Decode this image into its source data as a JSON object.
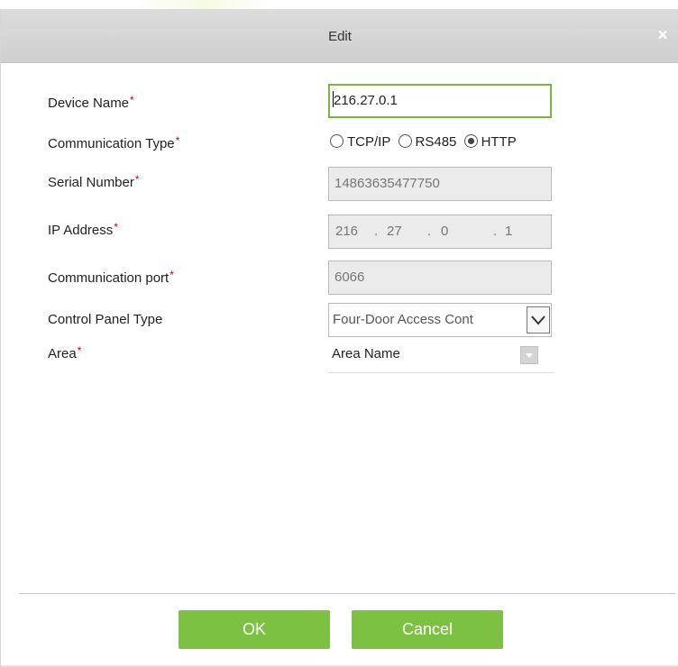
{
  "dialog": {
    "title": "Edit",
    "close_glyph": "×"
  },
  "form": {
    "device_name": {
      "label": "Device Name",
      "required_mark": "*",
      "value": "216.27.0.1"
    },
    "communication_type": {
      "label": "Communication Type",
      "required_mark": "*",
      "options": [
        "TCP/IP",
        "RS485",
        "HTTP"
      ],
      "selected": "HTTP"
    },
    "serial_number": {
      "label": "Serial Number",
      "required_mark": "*",
      "value": "14863635477750"
    },
    "ip_address": {
      "label": "IP Address",
      "required_mark": "*",
      "octets": [
        "216",
        "27",
        "0",
        "1"
      ],
      "separator": "."
    },
    "communication_port": {
      "label": "Communication port",
      "required_mark": "*",
      "value": "6066"
    },
    "control_panel_type": {
      "label": "Control Panel Type",
      "value": "Four-Door Access Cont"
    },
    "area": {
      "label": "Area",
      "required_mark": "*",
      "value": "Area Name"
    }
  },
  "buttons": {
    "ok": "OK",
    "cancel": "Cancel"
  },
  "colors": {
    "accent_green": "#7dc142",
    "required_red": "#cc0000",
    "titlebar_gray": "#d6d6d6"
  },
  "icons": {
    "close": "close-icon",
    "select_arrow": "chevron-down-icon",
    "combo_arrow": "dropdown-button-icon"
  }
}
